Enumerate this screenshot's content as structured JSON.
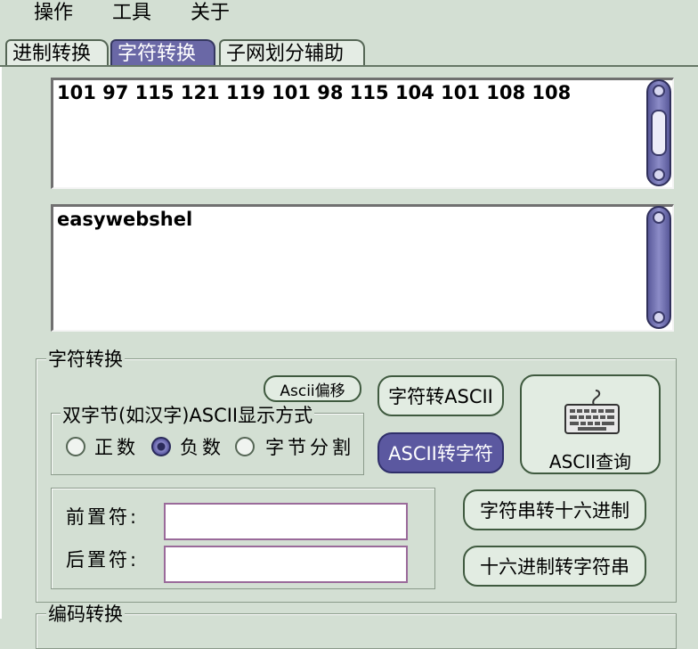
{
  "menu": [
    "操作",
    "工具",
    "关于"
  ],
  "tabs": [
    "进制转换",
    "字符转换",
    "子网划分辅助"
  ],
  "output_top": "101 97 115 121 119 101 98 115 104 101 108 108",
  "output_bottom": "easywebshel",
  "group_char": {
    "legend": "字符转换",
    "ascii_offset_button": "Ascii偏移",
    "dbcs_group_legend": "双字节(如汉字)ASCII显示方式",
    "radio_options": [
      "正数",
      "负数",
      "字节分割"
    ],
    "selected_radio": "负数",
    "prefix_label": "前置符:",
    "suffix_label": "后置符:",
    "prefix_value": "",
    "suffix_value": "",
    "char_to_ascii_button": "字符转ASCII",
    "ascii_to_char_button": "ASCII转字符",
    "ascii_lookup_button": "ASCII查询",
    "str_to_hex_button": "字符串转十六进制",
    "hex_to_str_button": "十六进制转字符串"
  },
  "group_encoding": {
    "legend": "编码转换"
  }
}
